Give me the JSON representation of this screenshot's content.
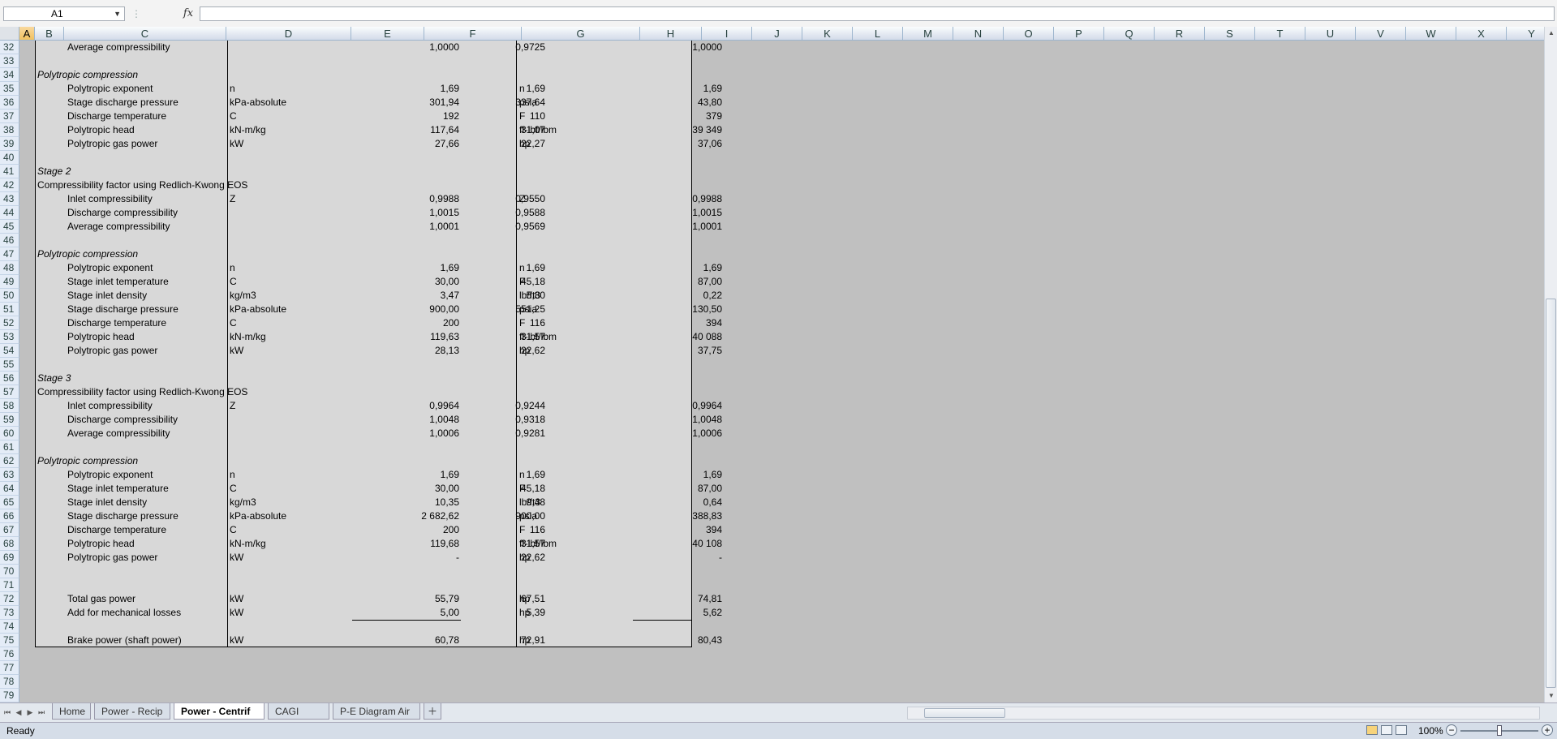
{
  "formula_bar": {
    "name_box": "A1",
    "formula": ""
  },
  "columns": [
    "A",
    "B",
    "C",
    "D",
    "E",
    "F",
    "G",
    "H",
    "I",
    "J",
    "K",
    "L",
    "M",
    "N",
    "O",
    "P",
    "Q",
    "R",
    "S",
    "T",
    "U",
    "V",
    "W",
    "X",
    "Y"
  ],
  "selected_column": "A",
  "rows": [
    {
      "n": "32",
      "label": "Average compressibility",
      "unit": "",
      "e": "1,0000",
      "f": "0,9725",
      "g": "",
      "h": "1,0000"
    },
    {
      "n": "33"
    },
    {
      "n": "34",
      "head": "Polytropic compression",
      "italic": true
    },
    {
      "n": "35",
      "label": "Polytropic exponent",
      "unit": "n",
      "e": "1,69",
      "f": "1,69",
      "g": "n",
      "h": "1,69"
    },
    {
      "n": "36",
      "label": "Stage discharge pressure",
      "unit": "kPa-absolute",
      "e": "301,94",
      "f": "337,64",
      "g": "psia",
      "h": "43,80"
    },
    {
      "n": "37",
      "label": "Discharge temperature",
      "unit": "C",
      "e": "192",
      "f": "110",
      "g": "F",
      "h": "379"
    },
    {
      "n": "38",
      "label": "Polytropic head",
      "unit": "kN-m/kg",
      "e": "117,64",
      "f": "31,07",
      "g": "ft-lbf/lbm",
      "h": "39 349"
    },
    {
      "n": "39",
      "label": "Polytropic gas power",
      "unit": "kW",
      "e": "27,66",
      "f": "22,27",
      "g": "hp",
      "h": "37,06"
    },
    {
      "n": "40"
    },
    {
      "n": "41",
      "head": "Stage 2",
      "italic": true
    },
    {
      "n": "42",
      "head": "Compressibility factor using Redlich-Kwong EOS",
      "italic": false
    },
    {
      "n": "43",
      "label": "Inlet compressibility",
      "unit": "Z",
      "e": "0,9988",
      "f": "0,9550",
      "g": "Z",
      "h": "0,9988"
    },
    {
      "n": "44",
      "label": "Discharge compressibility",
      "unit": "",
      "e": "1,0015",
      "f": "0,9588",
      "g": "",
      "h": "1,0015"
    },
    {
      "n": "45",
      "label": "Average compressibility",
      "unit": "",
      "e": "1,0001",
      "f": "0,9569",
      "g": "",
      "h": "1,0001"
    },
    {
      "n": "46"
    },
    {
      "n": "47",
      "head": "Polytropic compression",
      "italic": true
    },
    {
      "n": "48",
      "label": "Polytropic exponent",
      "unit": "n",
      "e": "1,69",
      "f": "1,69",
      "g": "n",
      "h": "1,69"
    },
    {
      "n": "49",
      "label": "Stage inlet temperature",
      "unit": "C",
      "e": "30,00",
      "f": "45,18",
      "g": "F",
      "h": "87,00"
    },
    {
      "n": "50",
      "label": "Stage inlet density",
      "unit": "kg/m3",
      "e": "3,47",
      "f": "5,80",
      "g": "lb/ft3",
      "h": "0,22"
    },
    {
      "n": "51",
      "label": "Stage discharge pressure",
      "unit": "kPa-absolute",
      "e": "900,00",
      "f": "551,25",
      "g": "psia",
      "h": "130,50"
    },
    {
      "n": "52",
      "label": "Discharge temperature",
      "unit": "C",
      "e": "200",
      "f": "116",
      "g": "F",
      "h": "394"
    },
    {
      "n": "53",
      "label": "Polytropic head",
      "unit": "kN-m/kg",
      "e": "119,63",
      "f": "31,57",
      "g": "ft-lbf/lbm",
      "h": "40 088"
    },
    {
      "n": "54",
      "label": "Polytropic gas power",
      "unit": "kW",
      "e": "28,13",
      "f": "22,62",
      "g": "hp",
      "h": "37,75"
    },
    {
      "n": "55"
    },
    {
      "n": "56",
      "head": "Stage 3",
      "italic": true
    },
    {
      "n": "57",
      "head": "Compressibility factor using Redlich-Kwong EOS",
      "italic": false
    },
    {
      "n": "58",
      "label": "Inlet compressibility",
      "unit": "Z",
      "e": "0,9964",
      "f": "0,9244",
      "g": "",
      "h": "0,9964"
    },
    {
      "n": "59",
      "label": "Discharge compressibility",
      "unit": "",
      "e": "1,0048",
      "f": "0,9318",
      "g": "",
      "h": "1,0048"
    },
    {
      "n": "60",
      "label": "Average compressibility",
      "unit": "",
      "e": "1,0006",
      "f": "0,9281",
      "g": "",
      "h": "1,0006"
    },
    {
      "n": "61"
    },
    {
      "n": "62",
      "head": "Polytropic compression",
      "italic": true
    },
    {
      "n": "63",
      "label": "Polytropic exponent",
      "unit": "n",
      "e": "1,69",
      "f": "1,69",
      "g": "n",
      "h": "1,69"
    },
    {
      "n": "64",
      "label": "Stage inlet temperature",
      "unit": "C",
      "e": "30,00",
      "f": "45,18",
      "g": "F",
      "h": "87,00"
    },
    {
      "n": "65",
      "label": "Stage inlet density",
      "unit": "kg/m3",
      "e": "10,35",
      "f": "9,48",
      "g": "lb/ft3",
      "h": "0,64"
    },
    {
      "n": "66",
      "label": "Stage discharge pressure",
      "unit": "kPa-absolute",
      "e": "2 682,62",
      "f": "900,00",
      "g": "psia",
      "h": "388,83"
    },
    {
      "n": "67",
      "label": "Discharge temperature",
      "unit": "C",
      "e": "200",
      "f": "116",
      "g": "F",
      "h": "394"
    },
    {
      "n": "68",
      "label": "Polytropic head",
      "unit": "kN-m/kg",
      "e": "119,68",
      "f": "31,57",
      "g": "ft-lbf/lbm",
      "h": "40 108"
    },
    {
      "n": "69",
      "label": "Polytropic gas power",
      "unit": "kW",
      "e": "-",
      "f": "22,62",
      "g": "hp",
      "h": "-"
    },
    {
      "n": "70"
    },
    {
      "n": "71"
    },
    {
      "n": "72",
      "label": "Total gas power",
      "unit": "kW",
      "e": "55,79",
      "f": "67,51",
      "g": "hp",
      "h": "74,81"
    },
    {
      "n": "73",
      "label": "Add for mechanical losses",
      "unit": "kW",
      "e": "5,00",
      "f": "5,39",
      "g": "hp",
      "h": "5,62"
    },
    {
      "n": "74"
    },
    {
      "n": "75",
      "label": "Brake power (shaft power)",
      "unit": "kW",
      "e": "60,78",
      "f": "72,91",
      "g": "hp",
      "h": "80,43"
    },
    {
      "n": "76"
    },
    {
      "n": "77"
    },
    {
      "n": "78"
    },
    {
      "n": "79"
    }
  ],
  "sheet_tabs": [
    "Home",
    "Power - Recip",
    "Power - Centrif",
    "CAGI Data",
    "P-E Diagram Air"
  ],
  "active_tab": "Power - Centrif",
  "status": {
    "text": "Ready",
    "zoom": "100%"
  }
}
